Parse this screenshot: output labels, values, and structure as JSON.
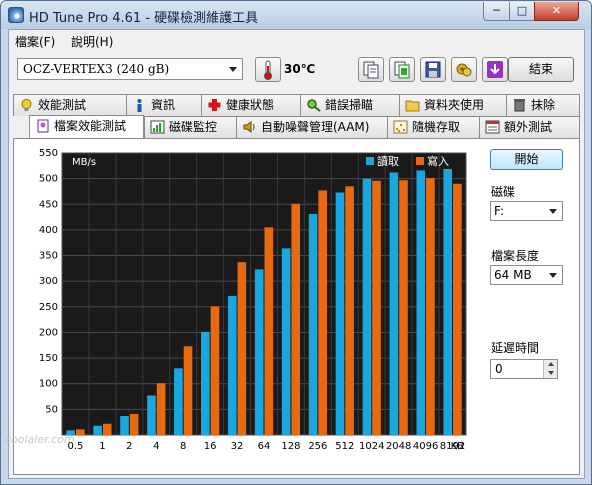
{
  "window": {
    "title": "HD Tune Pro 4.61 - 硬碟檢測維護工具",
    "min_label": "─",
    "max_label": "□",
    "close_label": "✕"
  },
  "menu": [
    {
      "label": "檔案(F)"
    },
    {
      "label": "說明(H)"
    }
  ],
  "toolbar": {
    "drive": "OCZ-VERTEX3 (240 gB)",
    "temperature": "30℃",
    "exit_label": "結束",
    "icons": [
      "copy-text-icon",
      "copy-screenshot-icon",
      "save-icon",
      "options-icon",
      "download-icon"
    ]
  },
  "tabs_row1": [
    {
      "label": "效能測試",
      "icon": "lightbulb-icon"
    },
    {
      "label": "資訊",
      "icon": "info-icon"
    },
    {
      "label": "健康狀態",
      "icon": "health-cross-icon"
    },
    {
      "label": "錯誤掃瞄",
      "icon": "magnifier-icon"
    },
    {
      "label": "資料夾使用",
      "icon": "folder-icon"
    },
    {
      "label": "抹除",
      "icon": "trash-icon"
    }
  ],
  "tabs_row2": [
    {
      "label": "檔案效能測試",
      "icon": "file-benchmark-icon",
      "active": true
    },
    {
      "label": "磁碟監控",
      "icon": "monitor-chart-icon"
    },
    {
      "label": "自動噪聲管理(AAM)",
      "icon": "speaker-icon"
    },
    {
      "label": "隨機存取",
      "icon": "random-access-icon"
    },
    {
      "label": "額外測試",
      "icon": "extra-tests-icon"
    }
  ],
  "side": {
    "start_label": "開始",
    "disk_label": "磁碟",
    "disk_value": "F:",
    "file_length_label": "檔案長度",
    "file_length_value": "64 MB",
    "delay_label": "延遲時間",
    "delay_value": "0"
  },
  "chart_data": {
    "type": "bar",
    "ylabel": "MB/s",
    "ylim": [
      0,
      550
    ],
    "yticks": [
      50,
      100,
      150,
      200,
      250,
      300,
      350,
      400,
      450,
      500,
      550
    ],
    "categories": [
      "0.5",
      "1",
      "2",
      "4",
      "8",
      "16",
      "32",
      "64",
      "128",
      "256",
      "512",
      "1024",
      "2048",
      "4096",
      "8192"
    ],
    "x_unit": "KB",
    "series": [
      {
        "name": "讀取",
        "color": "#1aa7e0",
        "values": [
          9,
          18,
          37,
          77,
          130,
          201,
          271,
          323,
          364,
          431,
          473,
          500,
          512,
          516,
          519
        ]
      },
      {
        "name": "寫入",
        "color": "#e86a10",
        "values": [
          11,
          22,
          41,
          101,
          173,
          251,
          337,
          405,
          451,
          477,
          485,
          496,
          497,
          501,
          490
        ]
      }
    ],
    "grid": true,
    "background": "#1a1a1a",
    "legend_position": "top-right"
  },
  "watermark": "coolaler.com"
}
